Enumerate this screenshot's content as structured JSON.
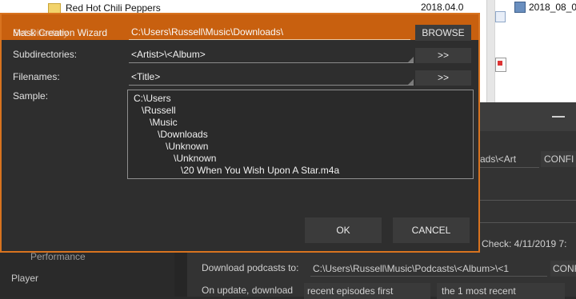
{
  "explorer": {
    "folder_name": "Red Hot Chili Peppers",
    "folder_date": "2018.04.0",
    "right_file": "2018_08_0"
  },
  "background_window": {
    "nav_item_performance": "Performance",
    "nav_item_player": "Player",
    "mask_field_text": "ads\\<Art",
    "config_button_1": "CONFI",
    "last_check_text": "Check: 4/11/2019 7:",
    "download_podcasts_label": "Download podcasts to:",
    "download_podcasts_path": "C:\\Users\\Russell\\Music\\Podcasts\\<Album>\\<1",
    "config_button_2": "CONF",
    "on_update_label": "On update, download",
    "update_option_1": "recent episodes first",
    "update_option_2": "the 1 most recent"
  },
  "dialog": {
    "title": "Mask Creation Wizard",
    "title_ghost": "Set Directory",
    "directory_value": "C:\\Users\\Russell\\Music\\Downloads\\",
    "browse_label": "BROWSE",
    "subdirectories_label": "Subdirectories:",
    "subdirectories_value": "<Artist>\\<Album>",
    "filenames_label": "Filenames:",
    "filenames_value": "<Title>",
    "insert_token_label": ">>",
    "sample_label": "Sample:",
    "sample_lines": [
      "C:\\Users",
      "\\Russell",
      "\\Music",
      "\\Downloads",
      "\\Unknown",
      "\\Unknown",
      "\\20 When You Wish Upon A Star.m4a"
    ],
    "ok_label": "OK",
    "cancel_label": "CANCEL",
    "accent_color": "#c8600f"
  }
}
